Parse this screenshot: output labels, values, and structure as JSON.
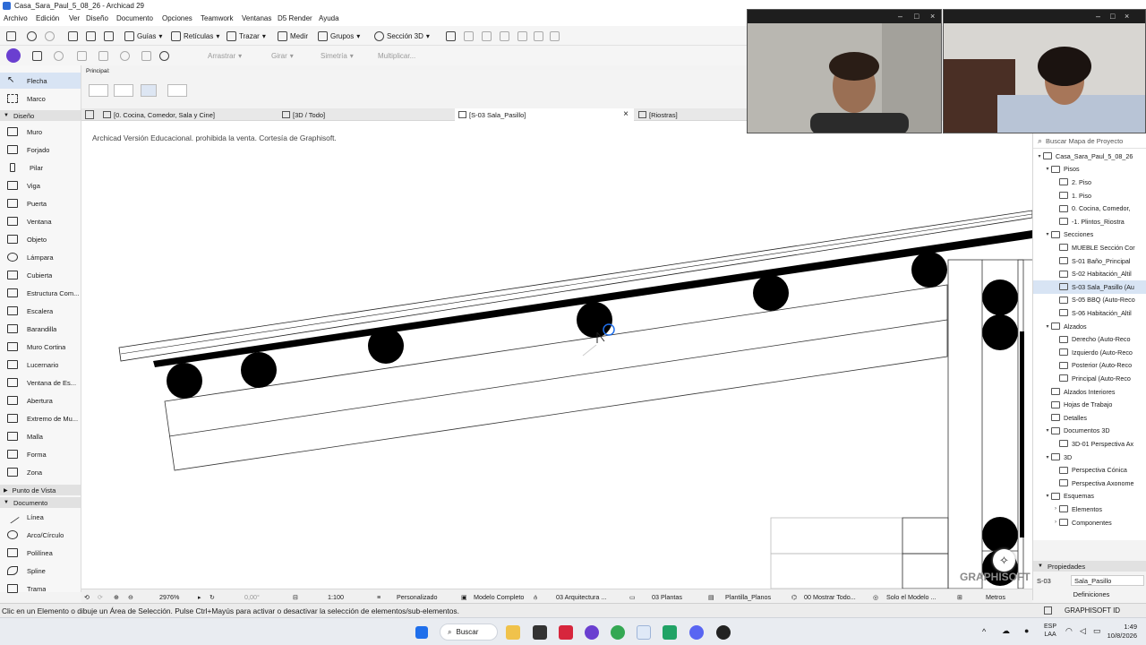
{
  "window": {
    "title": "Casa_Sara_Paul_5_08_26 - Archicad 29"
  },
  "menu": [
    "Archivo",
    "Edición",
    "Ver",
    "Diseño",
    "Documento",
    "Opciones",
    "Teamwork",
    "Ventanas",
    "D5 Render",
    "Ayuda"
  ],
  "toolbar": {
    "guias": "Guías",
    "reticulas": "Retículas",
    "trazar": "Trazar",
    "medir": "Medir",
    "grupos": "Grupos",
    "seccion3d": "Sección 3D",
    "arrastrar": "Arrastrar",
    "girar": "Girar",
    "simetria": "Simetría",
    "multiplicar": "Multiplicar..."
  },
  "principal": {
    "label": "Principal:"
  },
  "left_panel": {
    "flecha": "Flecha",
    "marco": "Marco",
    "diseno_header": "Diseño",
    "diseno_items": [
      "Muro",
      "Forjado",
      "Pilar",
      "Viga",
      "Puerta",
      "Ventana",
      "Objeto",
      "Lámpara",
      "Cubierta",
      "Estructura Com...",
      "Escalera",
      "Barandilla",
      "Muro Cortina",
      "Lucernario",
      "Ventana de Es...",
      "Abertura",
      "Extremo de Mu...",
      "Malla",
      "Forma",
      "Zona"
    ],
    "punto_de_vista": "Punto de Vista",
    "documento_header": "Documento",
    "documento_items": [
      "Línea",
      "Arco/Círculo",
      "Polilínea",
      "Spline",
      "Trama"
    ]
  },
  "tabs": [
    {
      "label": "[0. Cocina, Comedor, Sala y Cine]",
      "active": false
    },
    {
      "label": "[3D / Todo]",
      "active": false
    },
    {
      "label": "[S-03 Sala_Pasillo]",
      "active": true,
      "close": "×"
    },
    {
      "label": "[Riostras]",
      "active": false
    }
  ],
  "canvas": {
    "watermark": "Archicad Versión Educacional. prohibida la venta. Cortesía de Graphisoft.",
    "brand": "GRAPHISOFT"
  },
  "navigator": {
    "search_placeholder": "Buscar Mapa de Proyecto",
    "tree": [
      {
        "label": "Casa_Sara_Paul_5_08_26",
        "level": 0,
        "expander": "open"
      },
      {
        "label": "Pisos",
        "level": 1,
        "expander": "open"
      },
      {
        "label": "2. Piso",
        "level": 2
      },
      {
        "label": "1. Piso",
        "level": 2
      },
      {
        "label": "0. Cocina, Comedor,",
        "level": 2
      },
      {
        "label": "-1. Plintos_Riostra",
        "level": 2
      },
      {
        "label": "Secciones",
        "level": 1,
        "expander": "open"
      },
      {
        "label": "MUEBLE Sección Cor",
        "level": 2
      },
      {
        "label": "S-01 Baño_Principal",
        "level": 2
      },
      {
        "label": "S-02 Habitación_Altil",
        "level": 2
      },
      {
        "label": "S-03 Sala_Pasillo (Au",
        "level": 2,
        "selected": true
      },
      {
        "label": "S-05 BBQ (Auto-Reco",
        "level": 2
      },
      {
        "label": "S-06 Habitación_Altil",
        "level": 2
      },
      {
        "label": "Alzados",
        "level": 1,
        "expander": "open"
      },
      {
        "label": "Derecho (Auto-Reco",
        "level": 2
      },
      {
        "label": "Izquierdo (Auto-Reco",
        "level": 2
      },
      {
        "label": "Posterior (Auto-Reco",
        "level": 2
      },
      {
        "label": "Principal (Auto-Reco",
        "level": 2
      },
      {
        "label": "Alzados Interiores",
        "level": 1
      },
      {
        "label": "Hojas de Trabajo",
        "level": 1
      },
      {
        "label": "Detalles",
        "level": 1
      },
      {
        "label": "Documentos 3D",
        "level": 1,
        "expander": "open"
      },
      {
        "label": "3D-01 Perspectiva Ax",
        "level": 2
      },
      {
        "label": "3D",
        "level": 1,
        "expander": "open"
      },
      {
        "label": "Perspectiva Cónica",
        "level": 2
      },
      {
        "label": "Perspectiva Axonome",
        "level": 2
      },
      {
        "label": "Esquemas",
        "level": 1,
        "expander": "open"
      },
      {
        "label": "Elementos",
        "level": 2,
        "expander": "closed"
      },
      {
        "label": "Componentes",
        "level": 2,
        "expander": "closed"
      }
    ]
  },
  "properties": {
    "header": "Propiedades",
    "code": "S-03",
    "name": "Sala_Pasillo",
    "definiciones": "Definiciones",
    "graphisoft_id": "GRAPHISOFT ID"
  },
  "bottom_bar": {
    "zoom": "2976%",
    "angle": "0,00°",
    "scale": "1:100",
    "personalizado": "Personalizado",
    "modelo": "Modelo Completo",
    "arquitectura": "03 Arquitectura ...",
    "plantas": "03 Plantas",
    "plantilla": "Plantilla_Planos",
    "mostrar": "00 Mostrar Todo...",
    "solo_modelo": "Solo el Modelo ...",
    "unidades": "Metros"
  },
  "status": {
    "message": "Clic en un Elemento o dibuje un Área de Selección. Pulse Ctrl+Mayús para activar o desactivar la selección de elementos/sub-elementos."
  },
  "taskbar": {
    "search": "Buscar",
    "lang": "ESP",
    "region": "LAA",
    "time": "1:49",
    "date": "10/8/2026"
  },
  "colors": {
    "accent": "#1f6feb",
    "selection": "#d8e4f4",
    "drawing": "#000000"
  }
}
